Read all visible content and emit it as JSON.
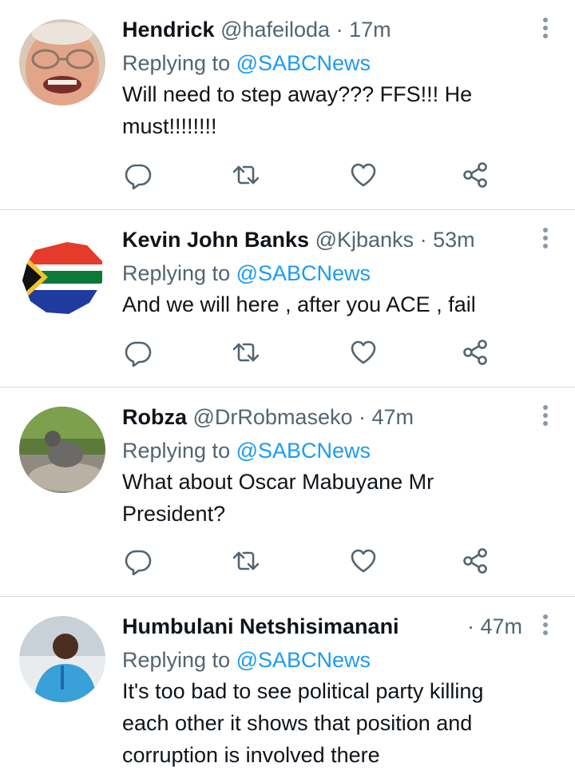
{
  "tweets": [
    {
      "name": "Hendrick",
      "handle": "@hafeiloda",
      "separator": "·",
      "time": "17m",
      "reply_prefix": "Replying to",
      "reply_to": "@SABCNews",
      "text": "Will need to step away??? FFS!!! He must!!!!!!!!"
    },
    {
      "name": "Kevin John Banks",
      "handle": "@Kjbanks",
      "separator": "·",
      "time": "53m",
      "reply_prefix": "Replying to",
      "reply_to": "@SABCNews",
      "text": "And we will here , after you ACE , fail"
    },
    {
      "name": "Robza",
      "handle": "@DrRobmaseko",
      "separator": "·",
      "time": "47m",
      "reply_prefix": "Replying to",
      "reply_to": "@SABCNews",
      "text": "What about Oscar Mabuyane Mr President?"
    },
    {
      "name": "Humbulani Netshisimanani",
      "handle": "",
      "separator": "·",
      "time": "47m",
      "reply_prefix": "Replying to",
      "reply_to": "@SABCNews",
      "text": "It's too bad to see political party killing each other it shows that position and corruption is involved there"
    }
  ],
  "icons": {
    "reply": "reply-icon",
    "retweet": "retweet-icon",
    "like": "heart-icon",
    "share": "share-icon",
    "more": "more-vertical-icon"
  },
  "colors": {
    "mention": "#1d9bf0",
    "secondary_text": "#536471",
    "divider": "#cfd9de"
  }
}
